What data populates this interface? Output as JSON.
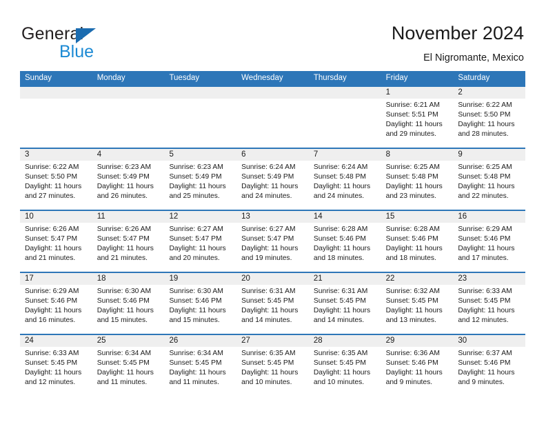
{
  "brand": {
    "name_part1": "General",
    "name_part2": "Blue",
    "accent_color": "#1c8ad4",
    "triangle_color": "#1b6cb0"
  },
  "header": {
    "title": "November 2024",
    "subtitle": "El Nigromante, Mexico",
    "header_bg": "#2d76b8",
    "datestrip_bg": "#efefef"
  },
  "weekdays": [
    "Sunday",
    "Monday",
    "Tuesday",
    "Wednesday",
    "Thursday",
    "Friday",
    "Saturday"
  ],
  "labels": {
    "sunrise_prefix": "Sunrise:",
    "sunset_prefix": "Sunset:",
    "daylight_prefix": "Daylight:"
  },
  "weeks": [
    [
      {
        "empty": true
      },
      {
        "empty": true
      },
      {
        "empty": true
      },
      {
        "empty": true
      },
      {
        "empty": true
      },
      {
        "day": "1",
        "sunrise": "Sunrise: 6:21 AM",
        "sunset": "Sunset: 5:51 PM",
        "daylight1": "Daylight: 11 hours",
        "daylight2": "and 29 minutes."
      },
      {
        "day": "2",
        "sunrise": "Sunrise: 6:22 AM",
        "sunset": "Sunset: 5:50 PM",
        "daylight1": "Daylight: 11 hours",
        "daylight2": "and 28 minutes."
      }
    ],
    [
      {
        "day": "3",
        "sunrise": "Sunrise: 6:22 AM",
        "sunset": "Sunset: 5:50 PM",
        "daylight1": "Daylight: 11 hours",
        "daylight2": "and 27 minutes."
      },
      {
        "day": "4",
        "sunrise": "Sunrise: 6:23 AM",
        "sunset": "Sunset: 5:49 PM",
        "daylight1": "Daylight: 11 hours",
        "daylight2": "and 26 minutes."
      },
      {
        "day": "5",
        "sunrise": "Sunrise: 6:23 AM",
        "sunset": "Sunset: 5:49 PM",
        "daylight1": "Daylight: 11 hours",
        "daylight2": "and 25 minutes."
      },
      {
        "day": "6",
        "sunrise": "Sunrise: 6:24 AM",
        "sunset": "Sunset: 5:49 PM",
        "daylight1": "Daylight: 11 hours",
        "daylight2": "and 24 minutes."
      },
      {
        "day": "7",
        "sunrise": "Sunrise: 6:24 AM",
        "sunset": "Sunset: 5:48 PM",
        "daylight1": "Daylight: 11 hours",
        "daylight2": "and 24 minutes."
      },
      {
        "day": "8",
        "sunrise": "Sunrise: 6:25 AM",
        "sunset": "Sunset: 5:48 PM",
        "daylight1": "Daylight: 11 hours",
        "daylight2": "and 23 minutes."
      },
      {
        "day": "9",
        "sunrise": "Sunrise: 6:25 AM",
        "sunset": "Sunset: 5:48 PM",
        "daylight1": "Daylight: 11 hours",
        "daylight2": "and 22 minutes."
      }
    ],
    [
      {
        "day": "10",
        "sunrise": "Sunrise: 6:26 AM",
        "sunset": "Sunset: 5:47 PM",
        "daylight1": "Daylight: 11 hours",
        "daylight2": "and 21 minutes."
      },
      {
        "day": "11",
        "sunrise": "Sunrise: 6:26 AM",
        "sunset": "Sunset: 5:47 PM",
        "daylight1": "Daylight: 11 hours",
        "daylight2": "and 21 minutes."
      },
      {
        "day": "12",
        "sunrise": "Sunrise: 6:27 AM",
        "sunset": "Sunset: 5:47 PM",
        "daylight1": "Daylight: 11 hours",
        "daylight2": "and 20 minutes."
      },
      {
        "day": "13",
        "sunrise": "Sunrise: 6:27 AM",
        "sunset": "Sunset: 5:47 PM",
        "daylight1": "Daylight: 11 hours",
        "daylight2": "and 19 minutes."
      },
      {
        "day": "14",
        "sunrise": "Sunrise: 6:28 AM",
        "sunset": "Sunset: 5:46 PM",
        "daylight1": "Daylight: 11 hours",
        "daylight2": "and 18 minutes."
      },
      {
        "day": "15",
        "sunrise": "Sunrise: 6:28 AM",
        "sunset": "Sunset: 5:46 PM",
        "daylight1": "Daylight: 11 hours",
        "daylight2": "and 18 minutes."
      },
      {
        "day": "16",
        "sunrise": "Sunrise: 6:29 AM",
        "sunset": "Sunset: 5:46 PM",
        "daylight1": "Daylight: 11 hours",
        "daylight2": "and 17 minutes."
      }
    ],
    [
      {
        "day": "17",
        "sunrise": "Sunrise: 6:29 AM",
        "sunset": "Sunset: 5:46 PM",
        "daylight1": "Daylight: 11 hours",
        "daylight2": "and 16 minutes."
      },
      {
        "day": "18",
        "sunrise": "Sunrise: 6:30 AM",
        "sunset": "Sunset: 5:46 PM",
        "daylight1": "Daylight: 11 hours",
        "daylight2": "and 15 minutes."
      },
      {
        "day": "19",
        "sunrise": "Sunrise: 6:30 AM",
        "sunset": "Sunset: 5:46 PM",
        "daylight1": "Daylight: 11 hours",
        "daylight2": "and 15 minutes."
      },
      {
        "day": "20",
        "sunrise": "Sunrise: 6:31 AM",
        "sunset": "Sunset: 5:45 PM",
        "daylight1": "Daylight: 11 hours",
        "daylight2": "and 14 minutes."
      },
      {
        "day": "21",
        "sunrise": "Sunrise: 6:31 AM",
        "sunset": "Sunset: 5:45 PM",
        "daylight1": "Daylight: 11 hours",
        "daylight2": "and 14 minutes."
      },
      {
        "day": "22",
        "sunrise": "Sunrise: 6:32 AM",
        "sunset": "Sunset: 5:45 PM",
        "daylight1": "Daylight: 11 hours",
        "daylight2": "and 13 minutes."
      },
      {
        "day": "23",
        "sunrise": "Sunrise: 6:33 AM",
        "sunset": "Sunset: 5:45 PM",
        "daylight1": "Daylight: 11 hours",
        "daylight2": "and 12 minutes."
      }
    ],
    [
      {
        "day": "24",
        "sunrise": "Sunrise: 6:33 AM",
        "sunset": "Sunset: 5:45 PM",
        "daylight1": "Daylight: 11 hours",
        "daylight2": "and 12 minutes."
      },
      {
        "day": "25",
        "sunrise": "Sunrise: 6:34 AM",
        "sunset": "Sunset: 5:45 PM",
        "daylight1": "Daylight: 11 hours",
        "daylight2": "and 11 minutes."
      },
      {
        "day": "26",
        "sunrise": "Sunrise: 6:34 AM",
        "sunset": "Sunset: 5:45 PM",
        "daylight1": "Daylight: 11 hours",
        "daylight2": "and 11 minutes."
      },
      {
        "day": "27",
        "sunrise": "Sunrise: 6:35 AM",
        "sunset": "Sunset: 5:45 PM",
        "daylight1": "Daylight: 11 hours",
        "daylight2": "and 10 minutes."
      },
      {
        "day": "28",
        "sunrise": "Sunrise: 6:35 AM",
        "sunset": "Sunset: 5:45 PM",
        "daylight1": "Daylight: 11 hours",
        "daylight2": "and 10 minutes."
      },
      {
        "day": "29",
        "sunrise": "Sunrise: 6:36 AM",
        "sunset": "Sunset: 5:46 PM",
        "daylight1": "Daylight: 11 hours",
        "daylight2": "and 9 minutes."
      },
      {
        "day": "30",
        "sunrise": "Sunrise: 6:37 AM",
        "sunset": "Sunset: 5:46 PM",
        "daylight1": "Daylight: 11 hours",
        "daylight2": "and 9 minutes."
      }
    ]
  ]
}
